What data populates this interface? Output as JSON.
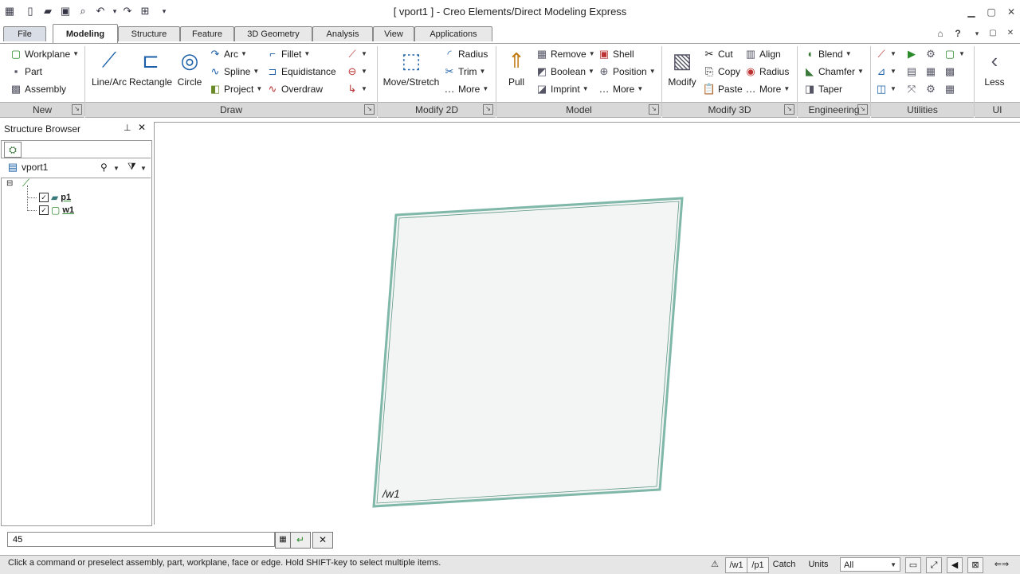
{
  "window": {
    "title": "[ vport1 ] - Creo Elements/Direct Modeling Express",
    "help": "?"
  },
  "tabs": [
    "File",
    "Modeling",
    "Structure",
    "Feature",
    "3D Geometry",
    "Analysis",
    "View",
    "Applications"
  ],
  "ribbon": {
    "new": {
      "workplane": "Workplane",
      "part": "Part",
      "assembly": "Assembly"
    },
    "draw": {
      "line_arc": "Line/Arc",
      "rectangle": "Rectangle",
      "circle": "Circle",
      "arc": "Arc",
      "spline": "Spline",
      "project": "Project",
      "fillet": "Fillet",
      "equidistance": "Equidistance",
      "overdraw": "Overdraw"
    },
    "modify2d": {
      "move_stretch": "Move/Stretch",
      "radius": "Radius",
      "trim": "Trim",
      "more": "More"
    },
    "model": {
      "pull": "Pull",
      "remove": "Remove",
      "boolean": "Boolean",
      "imprint": "Imprint",
      "shell": "Shell",
      "position": "Position",
      "more": "More"
    },
    "modify3d": {
      "modify": "Modify",
      "cut": "Cut",
      "copy": "Copy",
      "paste": "Paste",
      "align": "Align",
      "radius": "Radius",
      "more": "More"
    },
    "engineering": {
      "blend": "Blend",
      "chamfer": "Chamfer",
      "taper": "Taper"
    },
    "less": "Less",
    "groups": [
      "New",
      "Draw",
      "Modify 2D",
      "Model",
      "Modify 3D",
      "Engineering",
      "Utilities",
      "UI"
    ]
  },
  "structure_browser": {
    "title": "Structure Browser",
    "root": "vport1",
    "items": [
      {
        "label": "p1",
        "checked": true
      },
      {
        "label": "w1",
        "checked": true
      }
    ]
  },
  "viewport": {
    "workplane_label": "/w1"
  },
  "command_line": {
    "value": "45"
  },
  "status": {
    "message": "Click a command or preselect assembly, part, workplane, face or edge. Hold SHIFT-key to select multiple items.",
    "wp": "/w1",
    "part": "/p1",
    "catch": "Catch",
    "units": "Units",
    "filter": "All"
  },
  "colors": {
    "workplane_edge": "#7fb8a8",
    "workplane_fill": "#f3f5f4",
    "ribbon_bar": "#d8d8d8"
  }
}
